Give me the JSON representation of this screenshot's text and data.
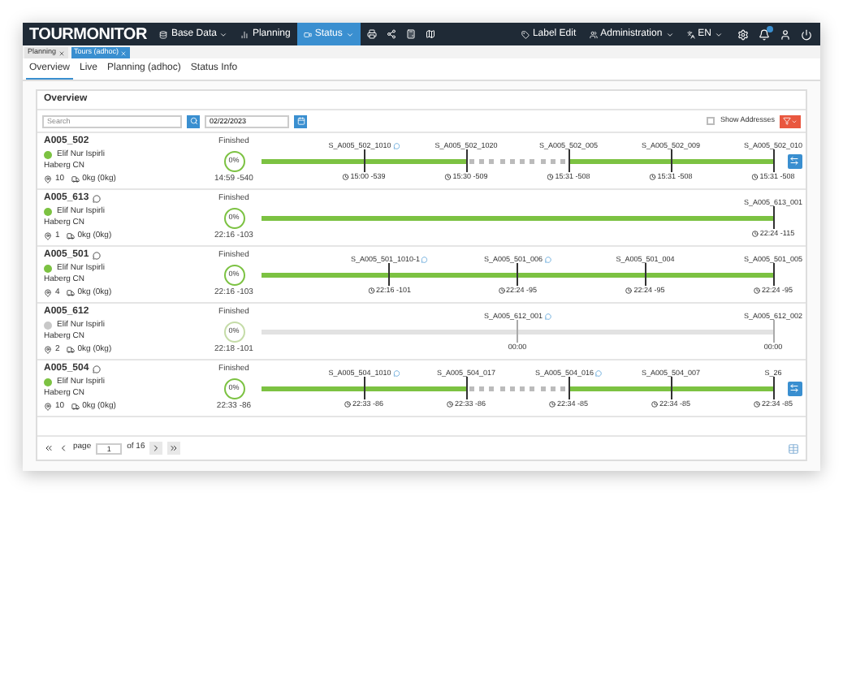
{
  "nav": {
    "logo": "TOURMONITOR",
    "items": [
      {
        "label": "Base Data",
        "dropdown": true,
        "selected": false
      },
      {
        "label": "Planning",
        "dropdown": false,
        "selected": false
      },
      {
        "label": "Status",
        "dropdown": true,
        "selected": true
      }
    ],
    "right": [
      {
        "label": "Label Edit",
        "dropdown": false
      },
      {
        "label": "Administration",
        "dropdown": true
      },
      {
        "label": "EN",
        "dropdown": true
      }
    ]
  },
  "doc_tabs": [
    {
      "label": "Planning",
      "selected": false
    },
    {
      "label": "Tours (adhoc)",
      "selected": true
    }
  ],
  "tabs": [
    {
      "label": "Overview",
      "selected": true
    },
    {
      "label": "Live",
      "selected": false
    },
    {
      "label": "Planning (adhoc)",
      "selected": false
    },
    {
      "label": "Status Info",
      "selected": false
    }
  ],
  "card": {
    "title": "Overview",
    "search": {
      "placeholder": "Search"
    },
    "date": "02/22/2023",
    "show_addresses": {
      "label": "Show Addresses",
      "checked": false
    }
  },
  "tours": [
    {
      "name": "A005_502",
      "comment": false,
      "color": "#7cc242",
      "driver": "Elif Nur Ispirli",
      "depot": "Haberg CN",
      "stops": "10",
      "weight": "0kg (0kg)",
      "status": "Finished",
      "progress": "0%",
      "start": "14:59 -540",
      "active": true,
      "button": true,
      "points": [
        {
          "label": "S_A005_502_1010",
          "comment": true,
          "time": "15:00 -539",
          "kind": "solid"
        },
        {
          "label": "S_A005_502_1020",
          "comment": false,
          "time": "15:30 -509",
          "kind": "solid"
        },
        {
          "label": "S_A005_502_005",
          "comment": false,
          "time": "15:31 -508",
          "kind": "dashed"
        },
        {
          "label": "S_A005_502_009",
          "comment": false,
          "time": "15:31 -508",
          "kind": "solid"
        },
        {
          "label": "S_A005_502_010",
          "comment": false,
          "time": "15:31 -508",
          "kind": "solid"
        }
      ]
    },
    {
      "name": "A005_613",
      "comment": true,
      "color": "#7cc242",
      "driver": "Elif Nur Ispirli",
      "depot": "Haberg CN",
      "stops": "1",
      "weight": "0kg (0kg)",
      "status": "Finished",
      "progress": "0%",
      "start": "22:16 -103",
      "active": true,
      "button": false,
      "points": [
        {
          "label": "S_A005_613_001",
          "comment": false,
          "time": "22:24 -115",
          "kind": "solid"
        }
      ]
    },
    {
      "name": "A005_501",
      "comment": true,
      "color": "#7cc242",
      "driver": "Elif Nur Ispirli",
      "depot": "Haberg CN",
      "stops": "4",
      "weight": "0kg (0kg)",
      "status": "Finished",
      "progress": "0%",
      "start": "22:16 -103",
      "active": true,
      "button": false,
      "points": [
        {
          "label": "S_A005_501_1010-1",
          "comment": true,
          "time": "22:16 -101",
          "kind": "solid"
        },
        {
          "label": "S_A005_501_006",
          "comment": true,
          "time": "22:24 -95",
          "kind": "solid"
        },
        {
          "label": "S_A005_501_004",
          "comment": false,
          "time": "22:24 -95",
          "kind": "solid"
        },
        {
          "label": "S_A005_501_005",
          "comment": false,
          "time": "22:24 -95",
          "kind": "solid"
        }
      ]
    },
    {
      "name": "A005_612",
      "comment": false,
      "color": "#c8c8c8",
      "driver": "Elif Nur Ispirli",
      "depot": "Haberg CN",
      "stops": "2",
      "weight": "0kg (0kg)",
      "status": "Finished",
      "progress": "0%",
      "start": "22:18 -101",
      "active": false,
      "button": false,
      "points": [
        {
          "label": "S_A005_612_001",
          "comment": true,
          "time": "00:00",
          "kind": "solid"
        },
        {
          "label": "S_A005_612_002",
          "comment": false,
          "time": "00:00",
          "kind": "solid"
        }
      ]
    },
    {
      "name": "A005_504",
      "comment": true,
      "color": "#7cc242",
      "driver": "Elif Nur Ispirli",
      "depot": "Haberg CN",
      "stops": "10",
      "weight": "0kg (0kg)",
      "status": "Finished",
      "progress": "0%",
      "start": "22:33 -86",
      "active": true,
      "button": true,
      "points": [
        {
          "label": "S_A005_504_1010",
          "comment": true,
          "time": "22:33 -86",
          "kind": "solid"
        },
        {
          "label": "S_A005_504_017",
          "comment": false,
          "time": "22:33 -86",
          "kind": "solid"
        },
        {
          "label": "S_A005_504_016",
          "comment": true,
          "time": "22:34 -85",
          "kind": "dashed"
        },
        {
          "label": "S_A005_504_007",
          "comment": false,
          "time": "22:34 -85",
          "kind": "solid"
        },
        {
          "label": "S_26",
          "comment": false,
          "time": "22:34 -85",
          "kind": "solid"
        }
      ]
    }
  ],
  "pager": {
    "label": "page",
    "value": "1",
    "of": "of 16"
  }
}
